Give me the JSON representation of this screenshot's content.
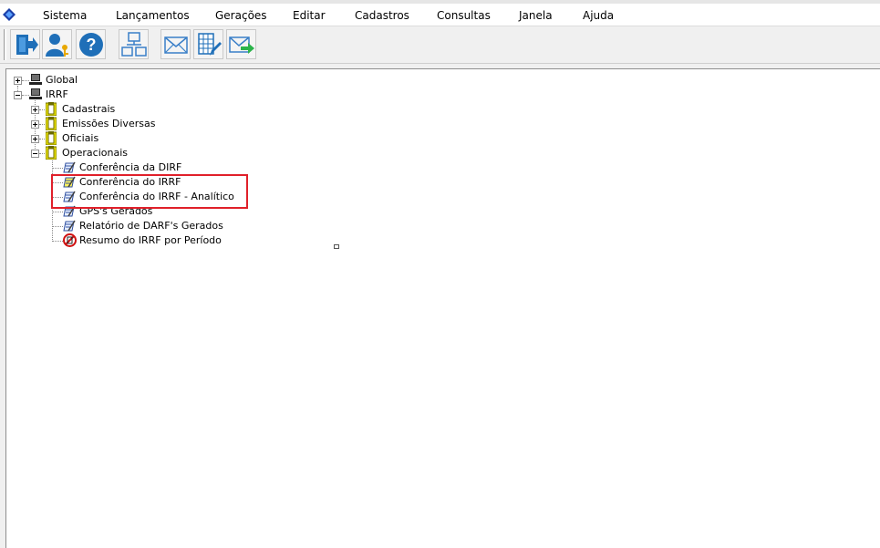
{
  "menu": {
    "items": [
      "Sistema",
      "Lançamentos",
      "Gerações",
      "Editar",
      "Cadastros",
      "Consultas",
      "Janela",
      "Ajuda"
    ]
  },
  "toolbar": {
    "buttons": [
      {
        "icon": "exit-door-icon"
      },
      {
        "icon": "user-key-icon"
      },
      {
        "icon": "help-icon"
      },
      {
        "icon": "org-chart-icon"
      },
      {
        "icon": "envelope-icon"
      },
      {
        "icon": "edit-sheet-icon"
      },
      {
        "icon": "send-mail-icon"
      }
    ]
  },
  "tree": {
    "global": "Global",
    "irrf": "IRRF",
    "cadastrais": "Cadastrais",
    "emissoes": "Emissões Diversas",
    "oficiais": "Oficiais",
    "operacionais": "Operacionais",
    "reports": {
      "conf_dirf": "Conferência da DIRF",
      "conf_irrf": "Conferência do IRRF",
      "conf_irrf_analitico": "Conferência do IRRF - Analítico",
      "gps": "GPS's Gerados",
      "darf": "Relatório de DARF's Gerados",
      "resumo": "Resumo do IRRF por Período"
    }
  },
  "colors": {
    "highlight": "#e0202a",
    "toolbar_blue": "#1f6fb8",
    "folder_yellow": "#e8e000"
  }
}
